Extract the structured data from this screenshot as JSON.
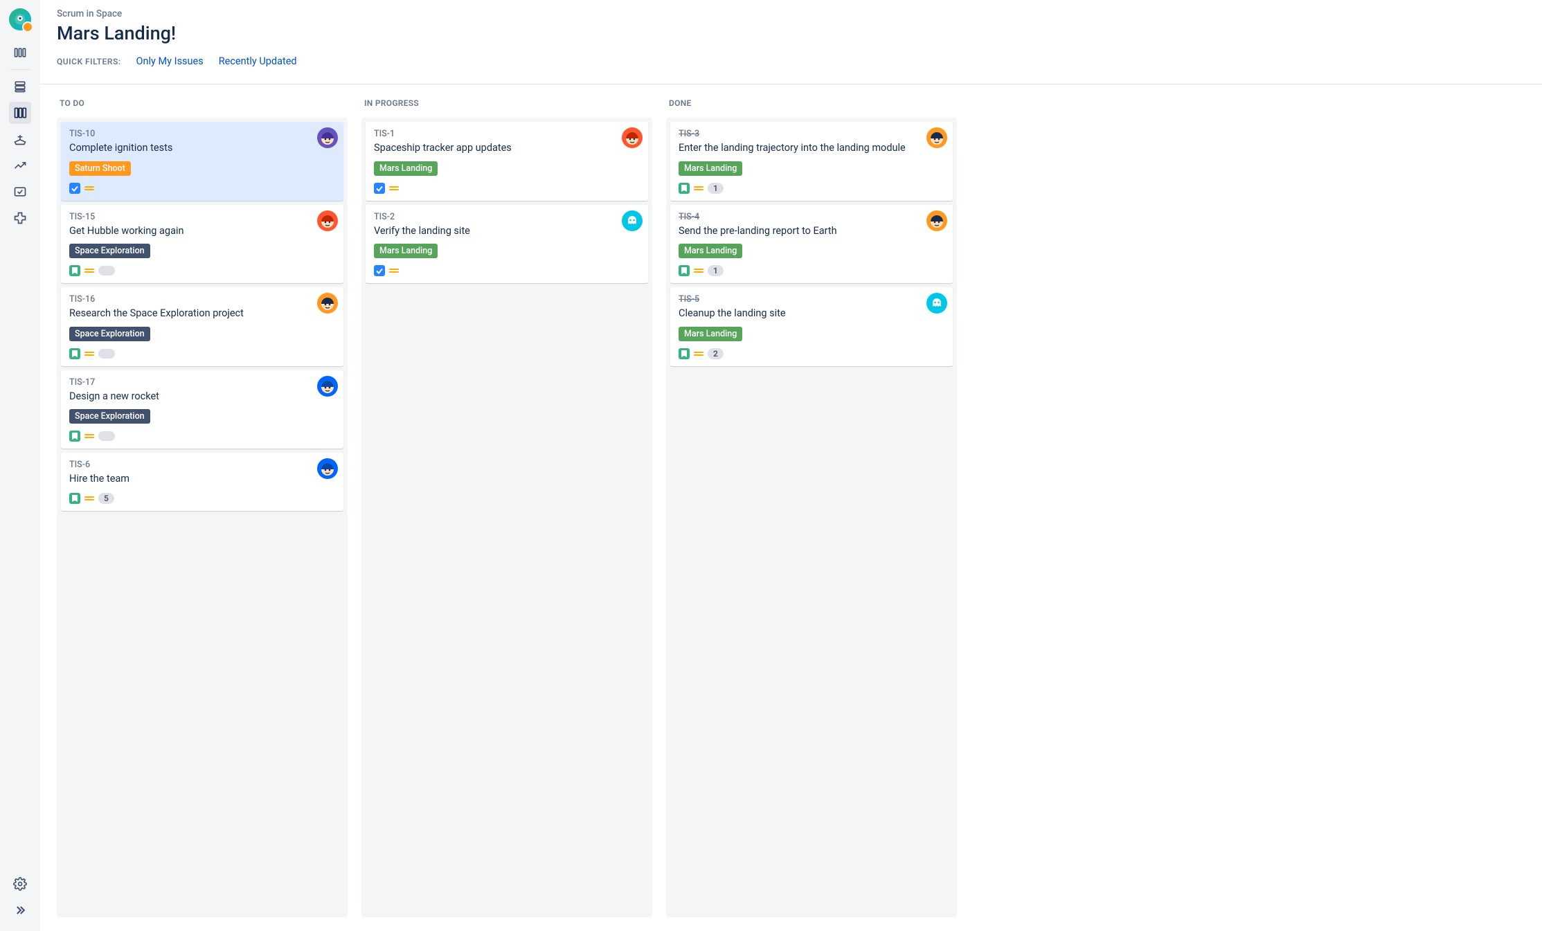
{
  "sidebar": {
    "items": [
      {
        "name": "board-group-icon"
      },
      {
        "name": "backlog-icon"
      },
      {
        "name": "board-icon",
        "active": true
      },
      {
        "name": "ship-icon"
      },
      {
        "name": "report-icon"
      },
      {
        "name": "checkbox-icon"
      },
      {
        "name": "addon-icon"
      }
    ]
  },
  "header": {
    "breadcrumb": "Scrum in Space",
    "title": "Mars Landing!",
    "filters_label": "QUICK FILTERS:",
    "filters": [
      {
        "label": "Only My Issues"
      },
      {
        "label": "Recently Updated"
      }
    ]
  },
  "colors": {
    "epic_saturn": "#FF991F",
    "epic_mars": "#57A55A",
    "epic_space": "#42526E"
  },
  "avatars": {
    "purple": "#6554C0",
    "red_santa": "#FF5630",
    "blue": "#0065FF",
    "orange_face": "#FF991F",
    "teal_ghost": "#00C7E6",
    "red_face": "#FF5630"
  },
  "columns": [
    {
      "title": "TO DO",
      "cards": [
        {
          "key": "TIS-10",
          "summary": "Complete ignition tests",
          "epic": {
            "label": "Saturn Shoot",
            "colorKey": "epic_saturn"
          },
          "type": "task",
          "priority": "medium",
          "avatar": "purple",
          "selected": true
        },
        {
          "key": "TIS-15",
          "summary": "Get Hubble working again",
          "epic": {
            "label": "Space Exploration",
            "colorKey": "epic_space"
          },
          "type": "story",
          "priority": "medium",
          "badge": "",
          "avatar": "red_santa"
        },
        {
          "key": "TIS-16",
          "summary": "Research the Space Exploration project",
          "epic": {
            "label": "Space Exploration",
            "colorKey": "epic_space"
          },
          "type": "story",
          "priority": "medium",
          "badge": "",
          "avatar": "orange_face"
        },
        {
          "key": "TIS-17",
          "summary": "Design a new rocket",
          "epic": {
            "label": "Space Exploration",
            "colorKey": "epic_space"
          },
          "type": "story",
          "priority": "medium",
          "badge": "",
          "avatar": "blue"
        },
        {
          "key": "TIS-6",
          "summary": "Hire the team",
          "type": "story",
          "priority": "medium",
          "badge": "5",
          "avatar": "blue"
        }
      ]
    },
    {
      "title": "IN PROGRESS",
      "cards": [
        {
          "key": "TIS-1",
          "summary": "Spaceship tracker app updates",
          "epic": {
            "label": "Mars Landing",
            "colorKey": "epic_mars"
          },
          "type": "task",
          "priority": "medium",
          "avatar": "red_face"
        },
        {
          "key": "TIS-2",
          "summary": "Verify the landing site",
          "epic": {
            "label": "Mars Landing",
            "colorKey": "epic_mars"
          },
          "type": "task",
          "priority": "medium",
          "avatar": "teal_ghost"
        }
      ]
    },
    {
      "title": "DONE",
      "cards": [
        {
          "key": "TIS-3",
          "summary": "Enter the landing trajectory into the landing module",
          "epic": {
            "label": "Mars Landing",
            "colorKey": "epic_mars"
          },
          "type": "story",
          "priority": "medium",
          "badge": "1",
          "avatar": "orange_face",
          "done": true
        },
        {
          "key": "TIS-4",
          "summary": "Send the pre-landing report to Earth",
          "epic": {
            "label": "Mars Landing",
            "colorKey": "epic_mars"
          },
          "type": "story",
          "priority": "medium",
          "badge": "1",
          "avatar": "orange_face",
          "done": true
        },
        {
          "key": "TIS-5",
          "summary": "Cleanup the landing site",
          "epic": {
            "label": "Mars Landing",
            "colorKey": "epic_mars"
          },
          "type": "story",
          "priority": "medium",
          "badge": "2",
          "avatar": "teal_ghost",
          "done": true
        }
      ]
    }
  ]
}
